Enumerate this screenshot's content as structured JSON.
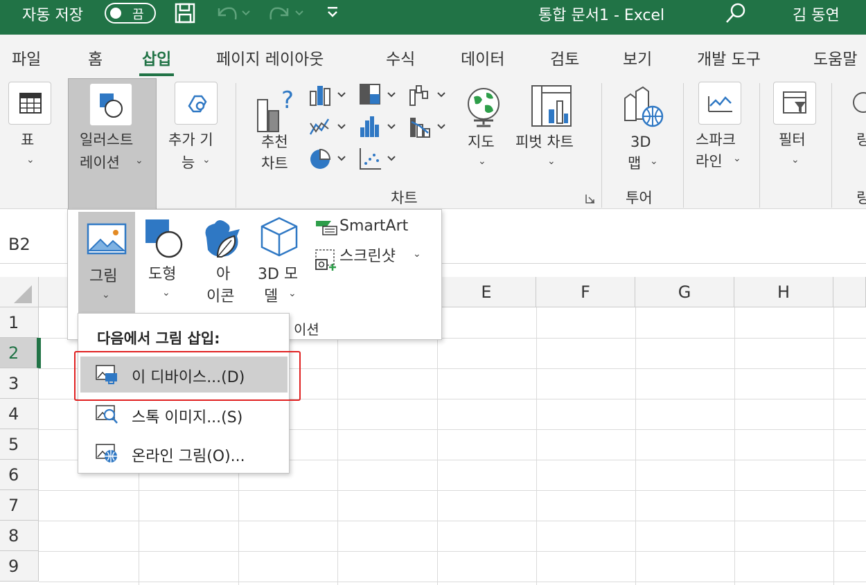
{
  "colors": {
    "brand": "#217346",
    "ribbon_bg": "#f3f3f3",
    "pressed": "#c6c6c6",
    "highlight_box": "#e02020",
    "icon_blue": "#2f78c4"
  },
  "titlebar": {
    "autosave_label": "자동 저장",
    "autosave_state": "끔",
    "document_title": "통합 문서1  -  Excel",
    "user_name": "김 동연"
  },
  "tabs": [
    "파일",
    "홈",
    "삽입",
    "페이지 레이아웃",
    "수식",
    "데이터",
    "검토",
    "보기",
    "개발 도구",
    "도움말"
  ],
  "active_tab": "삽입",
  "ribbon": {
    "table": {
      "label": "표"
    },
    "illustrations": {
      "label_line1": "일러스트",
      "label_line2": "레이션"
    },
    "addins": {
      "label_line1": "추가 기",
      "label_line2": "능"
    },
    "recommended_charts": {
      "label_line1": "추천",
      "label_line2": "차트"
    },
    "maps": {
      "label": "지도"
    },
    "pivot_chart": {
      "label": "피벗 차트"
    },
    "map3d": {
      "label_line1": "3D",
      "label_line2": "맵"
    },
    "sparklines": {
      "label_line1": "스파크",
      "label_line2": "라인"
    },
    "filters": {
      "label": "필터"
    },
    "group_charts": "차트",
    "group_tours": "투어",
    "partial_next": "링"
  },
  "namebox": {
    "value": "B2"
  },
  "illustrations_panel": {
    "picture": "그림",
    "shapes": "도형",
    "icons_line1": "아",
    "icons_line2": "이콘",
    "model3d_line1": "3D 모",
    "model3d_line2": "델",
    "smartart": "SmartArt",
    "screenshot": "스크린샷",
    "group_fragment": "이션"
  },
  "picture_menu": {
    "title": "다음에서 그림 삽입:",
    "items": [
      {
        "label": "이 디바이스...(D)",
        "icon": "device-picture-icon"
      },
      {
        "label": "스톡 이미지...(S)",
        "icon": "stock-image-icon"
      },
      {
        "label": "온라인 그림(O)...",
        "icon": "online-picture-icon"
      }
    ]
  },
  "grid": {
    "columns": [
      "E",
      "F",
      "G",
      "H"
    ],
    "rows": [
      "1",
      "2",
      "3",
      "4",
      "5",
      "6",
      "7",
      "8",
      "9"
    ],
    "selected_row": "2"
  }
}
